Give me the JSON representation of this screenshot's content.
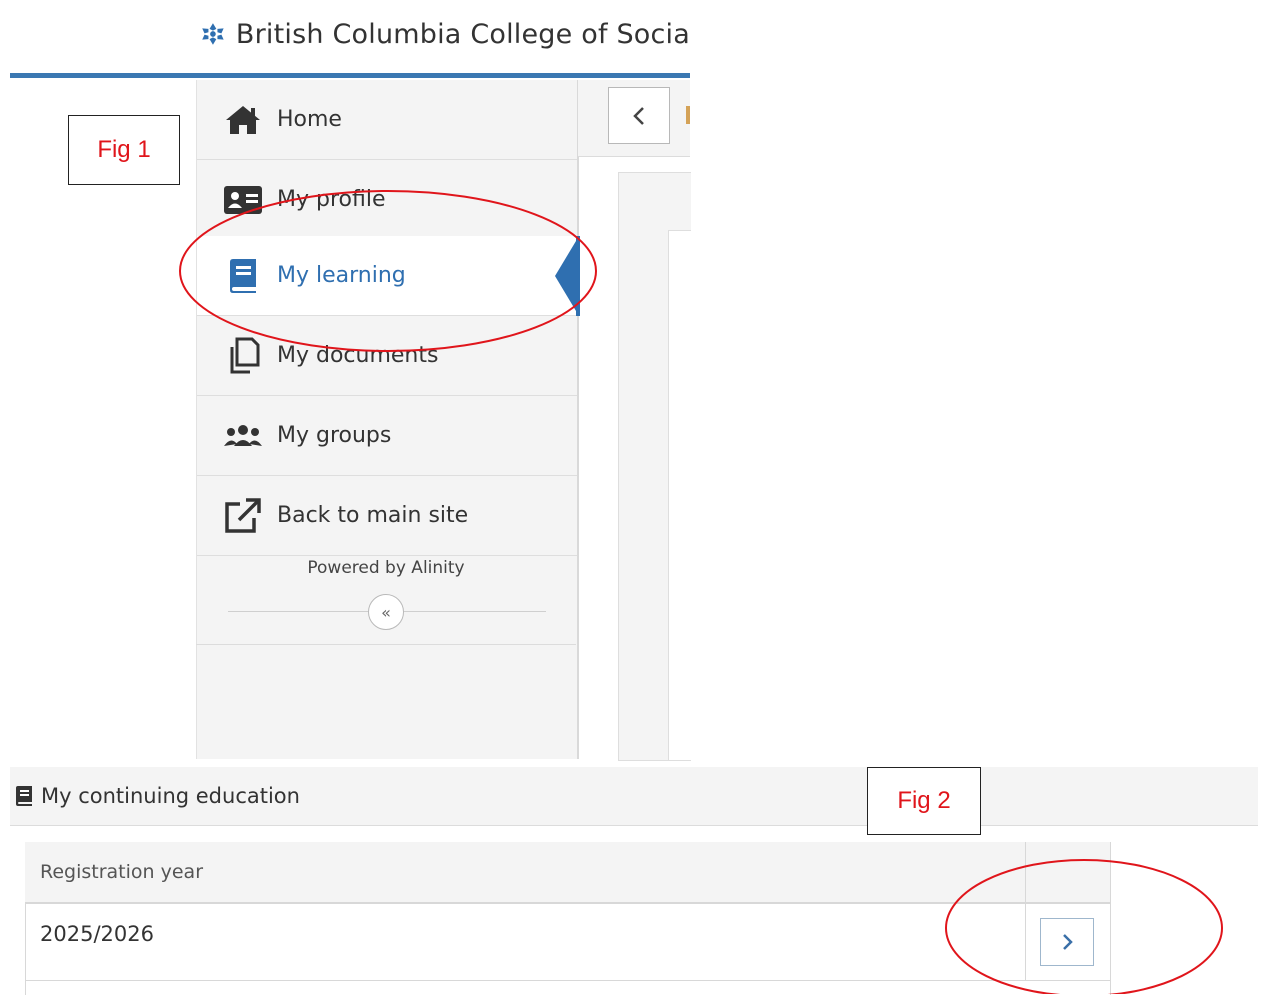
{
  "header": {
    "org_name": "British Columbia College of Socia",
    "brand_color": "#3b78b2"
  },
  "sidebar": {
    "items": [
      {
        "label": "Home",
        "icon": "home-icon"
      },
      {
        "label": "My profile",
        "icon": "id-card-icon"
      },
      {
        "label": "My learning",
        "icon": "book-icon",
        "active": true
      },
      {
        "label": "My documents",
        "icon": "documents-icon"
      },
      {
        "label": "My groups",
        "icon": "users-icon"
      },
      {
        "label": "Back to main site",
        "icon": "external-link-icon"
      }
    ],
    "powered_by": "Powered by Alinity",
    "collapse_glyph": "«",
    "active_color": "#2f6fb0"
  },
  "annotations": {
    "fig1": "Fig 1",
    "fig2": "Fig 2",
    "annotation_color": "#e0151b"
  },
  "continuing_education": {
    "title": "My continuing education",
    "table": {
      "columns": [
        "Registration year"
      ],
      "rows": [
        {
          "year": "2025/2026"
        }
      ]
    }
  }
}
